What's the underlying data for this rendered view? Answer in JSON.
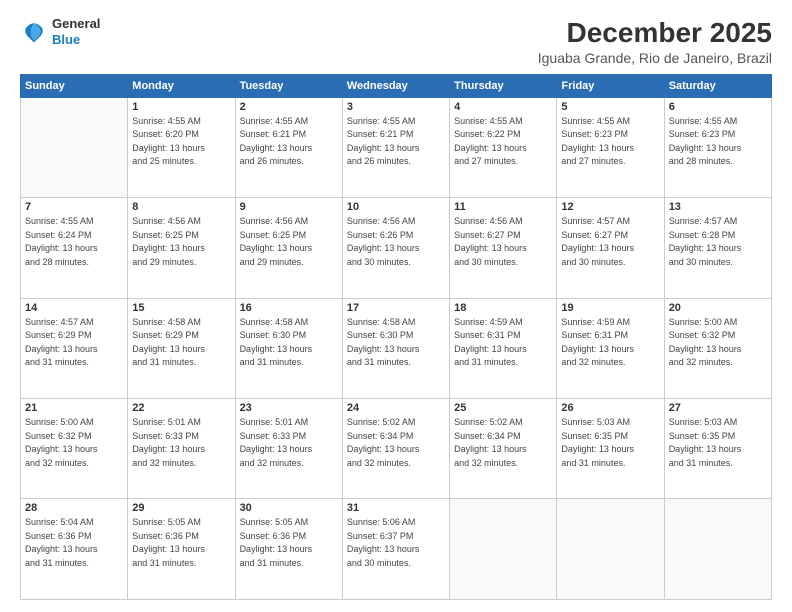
{
  "logo": {
    "line1": "General",
    "line2": "Blue"
  },
  "title": "December 2025",
  "subtitle": "Iguaba Grande, Rio de Janeiro, Brazil",
  "days_header": [
    "Sunday",
    "Monday",
    "Tuesday",
    "Wednesday",
    "Thursday",
    "Friday",
    "Saturday"
  ],
  "weeks": [
    [
      {
        "day": "",
        "info": ""
      },
      {
        "day": "1",
        "info": "Sunrise: 4:55 AM\nSunset: 6:20 PM\nDaylight: 13 hours\nand 25 minutes."
      },
      {
        "day": "2",
        "info": "Sunrise: 4:55 AM\nSunset: 6:21 PM\nDaylight: 13 hours\nand 26 minutes."
      },
      {
        "day": "3",
        "info": "Sunrise: 4:55 AM\nSunset: 6:21 PM\nDaylight: 13 hours\nand 26 minutes."
      },
      {
        "day": "4",
        "info": "Sunrise: 4:55 AM\nSunset: 6:22 PM\nDaylight: 13 hours\nand 27 minutes."
      },
      {
        "day": "5",
        "info": "Sunrise: 4:55 AM\nSunset: 6:23 PM\nDaylight: 13 hours\nand 27 minutes."
      },
      {
        "day": "6",
        "info": "Sunrise: 4:55 AM\nSunset: 6:23 PM\nDaylight: 13 hours\nand 28 minutes."
      }
    ],
    [
      {
        "day": "7",
        "info": "Sunrise: 4:55 AM\nSunset: 6:24 PM\nDaylight: 13 hours\nand 28 minutes."
      },
      {
        "day": "8",
        "info": "Sunrise: 4:56 AM\nSunset: 6:25 PM\nDaylight: 13 hours\nand 29 minutes."
      },
      {
        "day": "9",
        "info": "Sunrise: 4:56 AM\nSunset: 6:25 PM\nDaylight: 13 hours\nand 29 minutes."
      },
      {
        "day": "10",
        "info": "Sunrise: 4:56 AM\nSunset: 6:26 PM\nDaylight: 13 hours\nand 30 minutes."
      },
      {
        "day": "11",
        "info": "Sunrise: 4:56 AM\nSunset: 6:27 PM\nDaylight: 13 hours\nand 30 minutes."
      },
      {
        "day": "12",
        "info": "Sunrise: 4:57 AM\nSunset: 6:27 PM\nDaylight: 13 hours\nand 30 minutes."
      },
      {
        "day": "13",
        "info": "Sunrise: 4:57 AM\nSunset: 6:28 PM\nDaylight: 13 hours\nand 30 minutes."
      }
    ],
    [
      {
        "day": "14",
        "info": "Sunrise: 4:57 AM\nSunset: 6:29 PM\nDaylight: 13 hours\nand 31 minutes."
      },
      {
        "day": "15",
        "info": "Sunrise: 4:58 AM\nSunset: 6:29 PM\nDaylight: 13 hours\nand 31 minutes."
      },
      {
        "day": "16",
        "info": "Sunrise: 4:58 AM\nSunset: 6:30 PM\nDaylight: 13 hours\nand 31 minutes."
      },
      {
        "day": "17",
        "info": "Sunrise: 4:58 AM\nSunset: 6:30 PM\nDaylight: 13 hours\nand 31 minutes."
      },
      {
        "day": "18",
        "info": "Sunrise: 4:59 AM\nSunset: 6:31 PM\nDaylight: 13 hours\nand 31 minutes."
      },
      {
        "day": "19",
        "info": "Sunrise: 4:59 AM\nSunset: 6:31 PM\nDaylight: 13 hours\nand 32 minutes."
      },
      {
        "day": "20",
        "info": "Sunrise: 5:00 AM\nSunset: 6:32 PM\nDaylight: 13 hours\nand 32 minutes."
      }
    ],
    [
      {
        "day": "21",
        "info": "Sunrise: 5:00 AM\nSunset: 6:32 PM\nDaylight: 13 hours\nand 32 minutes."
      },
      {
        "day": "22",
        "info": "Sunrise: 5:01 AM\nSunset: 6:33 PM\nDaylight: 13 hours\nand 32 minutes."
      },
      {
        "day": "23",
        "info": "Sunrise: 5:01 AM\nSunset: 6:33 PM\nDaylight: 13 hours\nand 32 minutes."
      },
      {
        "day": "24",
        "info": "Sunrise: 5:02 AM\nSunset: 6:34 PM\nDaylight: 13 hours\nand 32 minutes."
      },
      {
        "day": "25",
        "info": "Sunrise: 5:02 AM\nSunset: 6:34 PM\nDaylight: 13 hours\nand 32 minutes."
      },
      {
        "day": "26",
        "info": "Sunrise: 5:03 AM\nSunset: 6:35 PM\nDaylight: 13 hours\nand 31 minutes."
      },
      {
        "day": "27",
        "info": "Sunrise: 5:03 AM\nSunset: 6:35 PM\nDaylight: 13 hours\nand 31 minutes."
      }
    ],
    [
      {
        "day": "28",
        "info": "Sunrise: 5:04 AM\nSunset: 6:36 PM\nDaylight: 13 hours\nand 31 minutes."
      },
      {
        "day": "29",
        "info": "Sunrise: 5:05 AM\nSunset: 6:36 PM\nDaylight: 13 hours\nand 31 minutes."
      },
      {
        "day": "30",
        "info": "Sunrise: 5:05 AM\nSunset: 6:36 PM\nDaylight: 13 hours\nand 31 minutes."
      },
      {
        "day": "31",
        "info": "Sunrise: 5:06 AM\nSunset: 6:37 PM\nDaylight: 13 hours\nand 30 minutes."
      },
      {
        "day": "",
        "info": ""
      },
      {
        "day": "",
        "info": ""
      },
      {
        "day": "",
        "info": ""
      }
    ]
  ]
}
